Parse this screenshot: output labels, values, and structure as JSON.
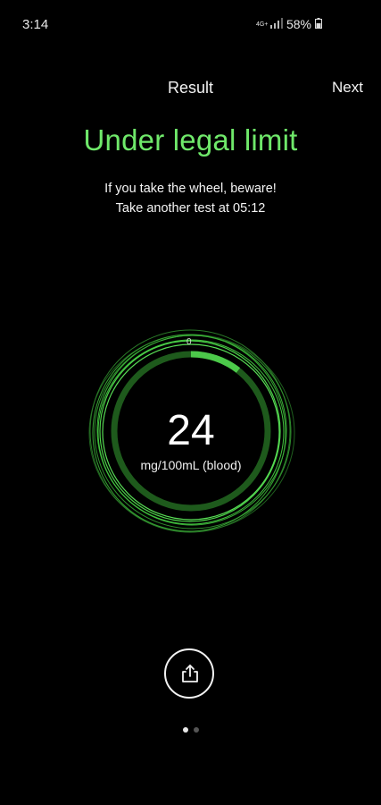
{
  "status_bar": {
    "time": "3:14",
    "network": "4G+",
    "battery": "58%"
  },
  "header": {
    "title": "Result",
    "next_label": "Next"
  },
  "result": {
    "heading": "Under legal limit",
    "line1": "If you take the wheel, beware!",
    "line2": "Take another test at 05:12"
  },
  "gauge": {
    "zero_label": "0",
    "value": "24",
    "unit": "mg/100mL (blood)",
    "accent_color": "#4cc94a"
  },
  "icons": {
    "share": "share-icon"
  },
  "pagination": {
    "total": 2,
    "current": 1
  },
  "colors": {
    "background": "#000000",
    "heading_green": "#6fe86a",
    "ring_green": "#3fbf3c"
  }
}
